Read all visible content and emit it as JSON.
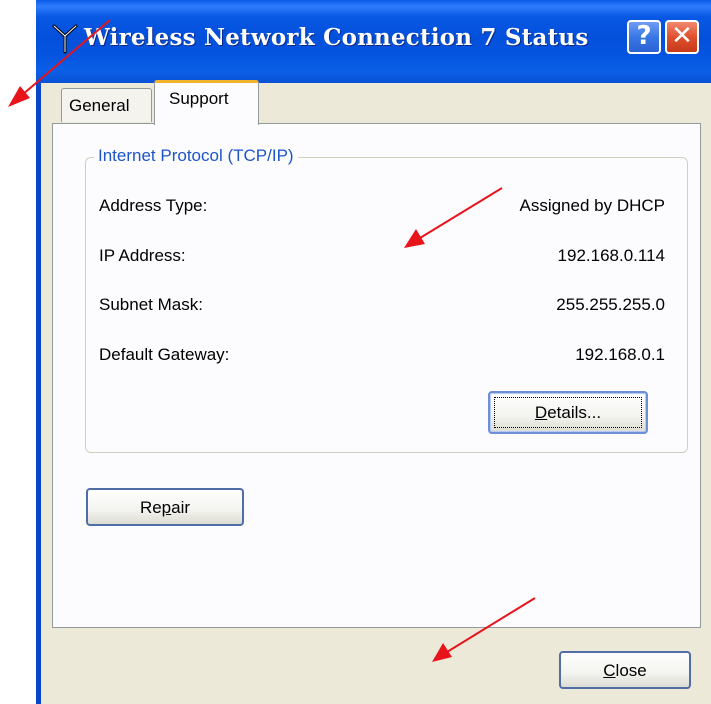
{
  "window": {
    "title": "Wireless Network Connection 7 Status",
    "title_icon": "wireless-antenna-icon",
    "help_button_label": "?",
    "close_button_label": "✕"
  },
  "tabs": [
    {
      "label": "General",
      "selected": false
    },
    {
      "label": "Support",
      "selected": true
    }
  ],
  "group": {
    "legend": "Internet Protocol (TCP/IP)",
    "rows": [
      {
        "label": "Address Type:",
        "value": "Assigned by DHCP"
      },
      {
        "label": "IP Address:",
        "value": "192.168.0.114"
      },
      {
        "label": "Subnet Mask:",
        "value": "255.255.255.0"
      },
      {
        "label": "Default Gateway:",
        "value": "192.168.0.1"
      }
    ],
    "details_button": {
      "pre": "",
      "accel": "D",
      "post": "etails..."
    }
  },
  "repair_button": {
    "pre": "Re",
    "accel": "p",
    "post": "air"
  },
  "close_button": {
    "pre": "",
    "accel": "C",
    "post": "lose"
  },
  "colors": {
    "title_bar": "#0350db",
    "face": "#ece9d8",
    "tab_accent": "#f4b32c",
    "legend_text": "#1c55c8",
    "annotation_arrow": "#e8141c"
  }
}
